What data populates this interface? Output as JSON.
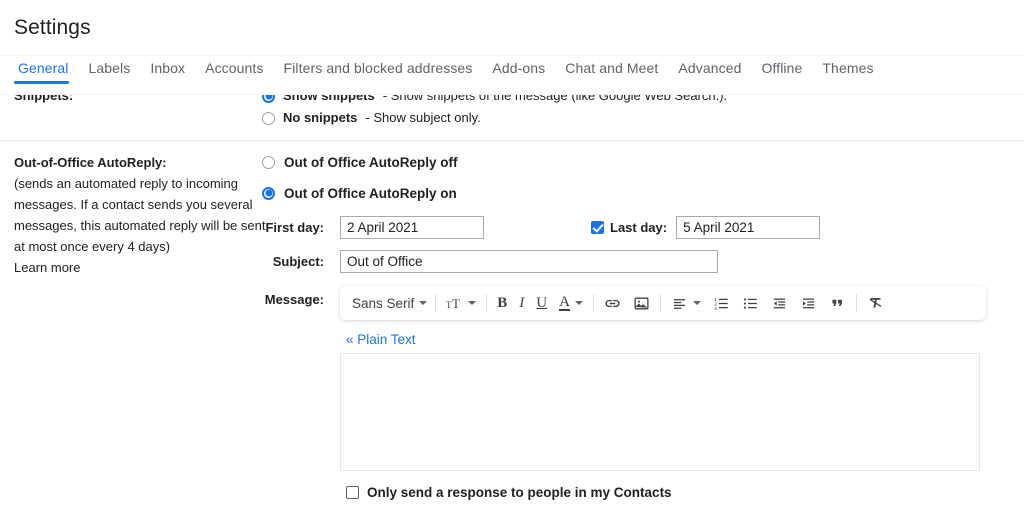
{
  "header": {
    "title": "Settings"
  },
  "tabs": [
    {
      "label": "General",
      "active": true
    },
    {
      "label": "Labels",
      "active": false
    },
    {
      "label": "Inbox",
      "active": false
    },
    {
      "label": "Accounts",
      "active": false
    },
    {
      "label": "Filters and blocked addresses",
      "active": false
    },
    {
      "label": "Add-ons",
      "active": false
    },
    {
      "label": "Chat and Meet",
      "active": false
    },
    {
      "label": "Advanced",
      "active": false
    },
    {
      "label": "Offline",
      "active": false
    },
    {
      "label": "Themes",
      "active": false
    }
  ],
  "snippets": {
    "label": "Snippets:",
    "show": {
      "bold": "Show snippets",
      "rest": "- Show snippets of the message (like Google Web Search.).",
      "selected": true
    },
    "no": {
      "bold": "No snippets",
      "rest": "- Show subject only.",
      "selected": false
    }
  },
  "out_of_office": {
    "heading": "Out-of-Office AutoReply:",
    "description": "(sends an automated reply to incoming messages. If a contact sends you several messages, this automated reply will be sent at most once every 4 days)",
    "learn_more": "Learn more",
    "option_off": {
      "label": "Out of Office AutoReply off",
      "selected": false
    },
    "option_on": {
      "label": "Out of Office AutoReply on",
      "selected": true
    },
    "first_day": {
      "label": "First day:",
      "value": "2 April 2021",
      "placeholder": ""
    },
    "last_day": {
      "label": "Last day:",
      "value": "5 April 2021",
      "placeholder": "",
      "enabled": true
    },
    "subject": {
      "label": "Subject:",
      "value": "Out of Office",
      "placeholder": ""
    },
    "message": {
      "label": "Message:",
      "value": "",
      "placeholder": ""
    },
    "plain_text_link": "« Plain Text",
    "only_contacts": {
      "label": "Only send a response to people in my Contacts",
      "checked": false
    }
  },
  "editor_toolbar": {
    "font": {
      "value": "Sans Serif",
      "icon": "chevron-down-icon"
    },
    "size": {
      "icon": "font-size-icon"
    },
    "bold": {
      "glyph": "B"
    },
    "italic": {
      "glyph": "I"
    },
    "underline": {
      "glyph": "U"
    },
    "text_color": {
      "glyph": "A",
      "icon": "chevron-down-icon"
    },
    "link": {
      "icon": "link-icon"
    },
    "image": {
      "icon": "image-icon"
    },
    "align": {
      "icon": "align-left-icon"
    },
    "numbered_list": {
      "icon": "numbered-list-icon"
    },
    "bulleted_list": {
      "icon": "bulleted-list-icon"
    },
    "indent_less": {
      "icon": "indent-decrease-icon"
    },
    "indent_more": {
      "icon": "indent-increase-icon"
    },
    "quote": {
      "icon": "block-quote-icon"
    },
    "remove_formatting": {
      "icon": "remove-formatting-icon"
    }
  },
  "colors": {
    "accent": "#1a73e8",
    "text": "#202124",
    "muted": "#5f6368",
    "divider": "#ebebeb"
  }
}
